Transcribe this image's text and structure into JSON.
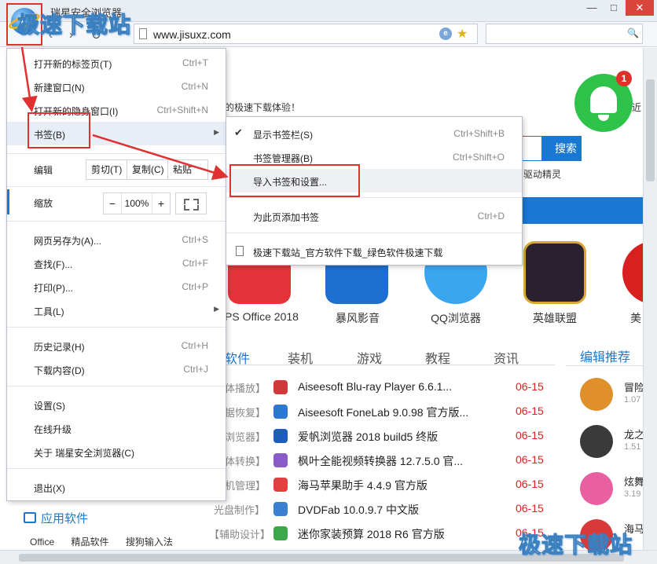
{
  "window": {
    "title": "瑞星安全浏览器",
    "min_symbol": "—",
    "max_symbol": "□",
    "close_symbol": "✕"
  },
  "toolbar": {
    "back": "‹",
    "forward": "›",
    "refresh": "↻",
    "url": "www.jisuxz.com"
  },
  "watermark": "极速下载站",
  "page": {
    "welcome": "的极速下载体验！",
    "recent": "最近",
    "search_btn": "搜索",
    "driver": "驱动精灵",
    "apps": [
      {
        "name": "WPS Office 2018",
        "visible": "PS Office 2018",
        "color": "#e4343a"
      },
      {
        "name": "暴风影音",
        "color": "#1f6fd0"
      },
      {
        "name": "QQ浏览器",
        "color": "#3aa6f0"
      },
      {
        "name": "英雄联盟",
        "color": "#d8a832"
      },
      {
        "name": "美",
        "color": "#d82020"
      }
    ],
    "tabs": [
      "软件",
      "装机",
      "游戏",
      "教程",
      "资讯"
    ],
    "editor_title": "编辑推荐",
    "software": [
      {
        "cat": "体播放】",
        "name": "Aiseesoft Blu-ray Player 6.6.1...",
        "date": "06-15",
        "color": "#cc3a3a"
      },
      {
        "cat": "据恢复】",
        "name": "Aiseesoft FoneLab 9.0.98 官方版...",
        "date": "06-15",
        "color": "#2a78d0"
      },
      {
        "cat": "浏览器】",
        "name": "爱帆浏览器 2018 build5 终版",
        "date": "06-15",
        "color": "#1d5fb8"
      },
      {
        "cat": "体转换】",
        "name": "枫叶全能视频转换器 12.7.5.0 官...",
        "date": "06-15",
        "color": "#8a5ac8"
      },
      {
        "cat": "机管理】",
        "name": "海马苹果助手 4.4.9 官方版",
        "date": "06-15",
        "color": "#e04040"
      },
      {
        "cat": "光盘制作】",
        "name": "DVDFab 10.0.9.7 中文版",
        "date": "06-15",
        "color": "#3a7fd0"
      },
      {
        "cat": "【辅助设计】",
        "name": "迷你家装预算 2018 R6 官方版",
        "date": "06-15",
        "color": "#3aa84a"
      }
    ],
    "recommend": [
      {
        "name": "冒险",
        "sub": "1.07",
        "color": "#e0902a"
      },
      {
        "name": "龙之",
        "sub": "1.51",
        "color": "#3a3a3a"
      },
      {
        "name": "炫舞",
        "sub": "3.19",
        "color": "#e860a0"
      },
      {
        "name": "海马",
        "sub": "",
        "color": "#d83a3a"
      }
    ],
    "apps_section": {
      "title": "应用软件",
      "links": [
        "Office",
        "精品软件",
        "搜狗输入法"
      ]
    },
    "bell_badge": "1"
  },
  "menu": {
    "new_tab": {
      "label": "打开新的标签页(T)",
      "shortcut": "Ctrl+T"
    },
    "new_window": {
      "label": "新建窗口(N)",
      "shortcut": "Ctrl+N"
    },
    "incognito": {
      "label": "打开新的隐身窗口(I)",
      "shortcut": "Ctrl+Shift+N"
    },
    "bookmarks": {
      "label": "书签(B)",
      "arrow": "▶"
    },
    "edit": {
      "label": "编辑",
      "cut": "剪切(T)",
      "copy": "复制(C)",
      "paste": "粘贴"
    },
    "zoom": {
      "label": "缩放",
      "minus": "−",
      "value": "100%",
      "plus": "+"
    },
    "save_as": {
      "label": "网页另存为(A)...",
      "shortcut": "Ctrl+S"
    },
    "find": {
      "label": "查找(F)...",
      "shortcut": "Ctrl+F"
    },
    "print": {
      "label": "打印(P)...",
      "shortcut": "Ctrl+P"
    },
    "tools": {
      "label": "工具(L)",
      "arrow": "▶"
    },
    "history": {
      "label": "历史记录(H)",
      "shortcut": "Ctrl+H"
    },
    "downloads": {
      "label": "下载内容(D)",
      "shortcut": "Ctrl+J"
    },
    "settings": {
      "label": "设置(S)"
    },
    "upgrade": {
      "label": "在线升级"
    },
    "about": {
      "label": "关于 瑞星安全浏览器(C)"
    },
    "exit": {
      "label": "退出(X)"
    }
  },
  "submenu": {
    "show_bar": {
      "label": "显示书签栏(S)",
      "shortcut": "Ctrl+Shift+B",
      "check": "✔"
    },
    "manager": {
      "label": "书签管理器(B)",
      "shortcut": "Ctrl+Shift+O"
    },
    "import": {
      "label": "导入书签和设置..."
    },
    "add_page": {
      "label": "为此页添加书签",
      "shortcut": "Ctrl+D"
    },
    "site_bookmark": {
      "label": "极速下载站_官方软件下载_绿色软件极速下载"
    }
  },
  "colors": {
    "accent": "#1a78d3",
    "annotation": "#e03030",
    "date": "#e02020",
    "bell": "#2fc24a"
  }
}
